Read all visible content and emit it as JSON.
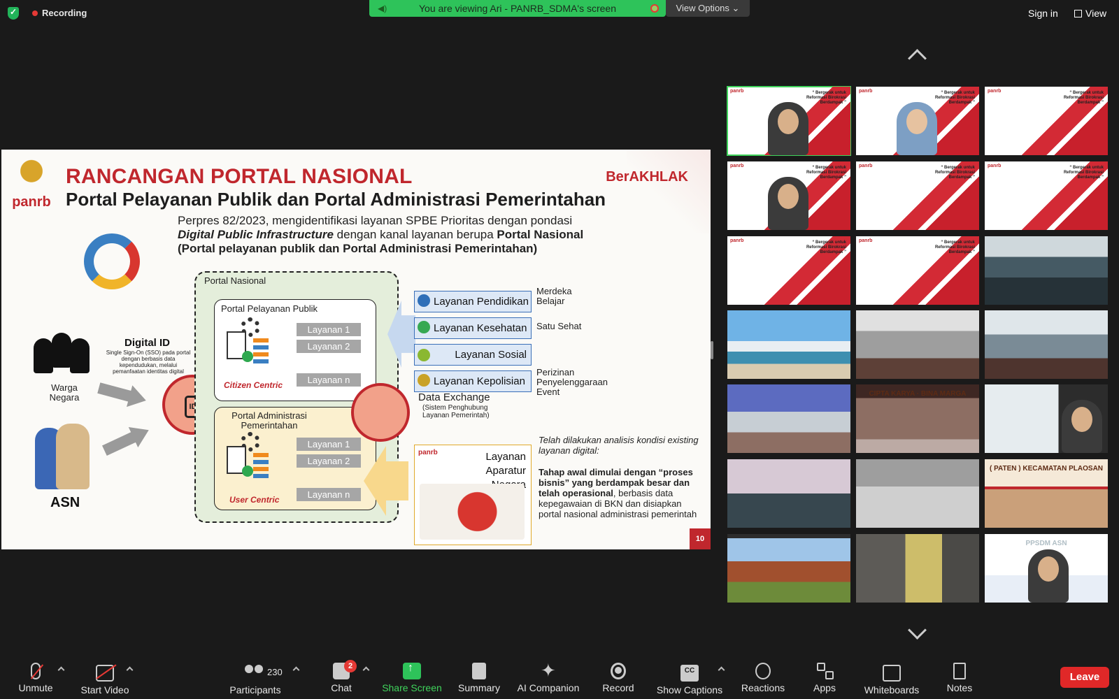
{
  "topbar": {
    "recording": "Recording",
    "viewing": "You are viewing Ari - PANRB_SDMA's screen",
    "view_options": "View Options",
    "sign_in": "Sign in",
    "view": "View"
  },
  "slide": {
    "logo_text": "panrb",
    "title1": "RANCANGAN PORTAL NASIONAL",
    "title2": "Portal Pelayanan Publik dan Portal Administrasi Pemerintahan",
    "berakhlak": "BerAKHLAK",
    "perpres_line1": "Perpres 82/2023, mengidentifikasi layanan SPBE Prioritas dengan pondasi",
    "perpres_dpi": "Digital Public Infrastructure",
    "perpres_mid": " dengan kanal layanan berupa ",
    "perpres_portal": "Portal Nasional",
    "perpres_line3": "(Portal pelayanan publik dan Portal Administrasi Pemerintahan)",
    "warga_negara": "Warga Negara",
    "asn": "ASN",
    "digital_id_title": "Digital ID",
    "digital_id_text": "Single Sign-On (SSO) pada portal dengan berbasis data kependudukan, melalui pemanfaatan identitas digital",
    "id_label": "ID",
    "portal_nasional": "Portal Nasional",
    "portal_publik": "Portal Pelayanan Publik",
    "portal_admin": "Portal Administrasi Pemerintahan",
    "layanan_publik": [
      "Layanan 1",
      "Layanan 2",
      "Layanan n"
    ],
    "layanan_admin": [
      "Layanan 1",
      "Layanan 2",
      "Layanan n"
    ],
    "citizen_centric": "Citizen Centric",
    "user_centric": "User Centric",
    "data_exchange": "Data Exchange",
    "data_exchange_sub": "(Sistem Penghubung Layanan Pemerintah)",
    "services": [
      {
        "label": "Layanan Pendidikan",
        "note": "Merdeka Belajar",
        "color": "#2f6fb8"
      },
      {
        "label": "Layanan Kesehatan",
        "note": "Satu Sehat",
        "color": "#36a852"
      },
      {
        "label": "Layanan Sosial",
        "note": "",
        "color": "#8ab832"
      },
      {
        "label": "Layanan Kepolisian",
        "note": "Perizinan Penyelenggaraan Event",
        "color": "#c9a227"
      }
    ],
    "lan_logo": "panrb",
    "lan_title": "Layanan Aparatur Negara",
    "analisis": "Telah dilakukan analisis kondisi existing layanan digital:",
    "tahap_bold": "Tahap awal dimulai dengan “proses bisnis” yang berdampak besar dan telah operasional",
    "tahap_rest": ", berbasis data kepegawaian di BKN dan disiapkan portal nasional administrasi pemerintah",
    "page_number": "10"
  },
  "gallery": {
    "tiles": [
      {
        "kind": "panrb-face",
        "active": true
      },
      {
        "kind": "panrb-hijab"
      },
      {
        "kind": "panrb"
      },
      {
        "kind": "panrb-face2"
      },
      {
        "kind": "panrb"
      },
      {
        "kind": "panrb"
      },
      {
        "kind": "panrb"
      },
      {
        "kind": "panrb"
      },
      {
        "kind": "office"
      },
      {
        "kind": "beach"
      },
      {
        "kind": "hall"
      },
      {
        "kind": "office2"
      },
      {
        "kind": "room-blue"
      },
      {
        "kind": "building"
      },
      {
        "kind": "person-side"
      },
      {
        "kind": "meeting"
      },
      {
        "kind": "meeting2"
      },
      {
        "kind": "paten"
      },
      {
        "kind": "pendopo"
      },
      {
        "kind": "hijab-room"
      },
      {
        "kind": "person-asn"
      }
    ],
    "tile_quote": "“ Bergerak untuk Reformasi Birokrasi Berdampak ”",
    "tile_badge": "panrb",
    "paten_text": "( PATEN ) KECAMATAN PLAOSAN",
    "cipta_text": "CIPTA KARYA · BINA MARGA",
    "ppsdm_text": "PPSDM ASN"
  },
  "toolbar": {
    "unmute": "Unmute",
    "start_video": "Start Video",
    "participants": "Participants",
    "participant_count": "230",
    "chat": "Chat",
    "chat_badge": "2",
    "share_screen": "Share Screen",
    "summary": "Summary",
    "ai_companion": "AI Companion",
    "record": "Record",
    "show_captions": "Show Captions",
    "cc": "CC",
    "reactions": "Reactions",
    "apps": "Apps",
    "whiteboards": "Whiteboards",
    "notes": "Notes",
    "leave": "Leave"
  }
}
